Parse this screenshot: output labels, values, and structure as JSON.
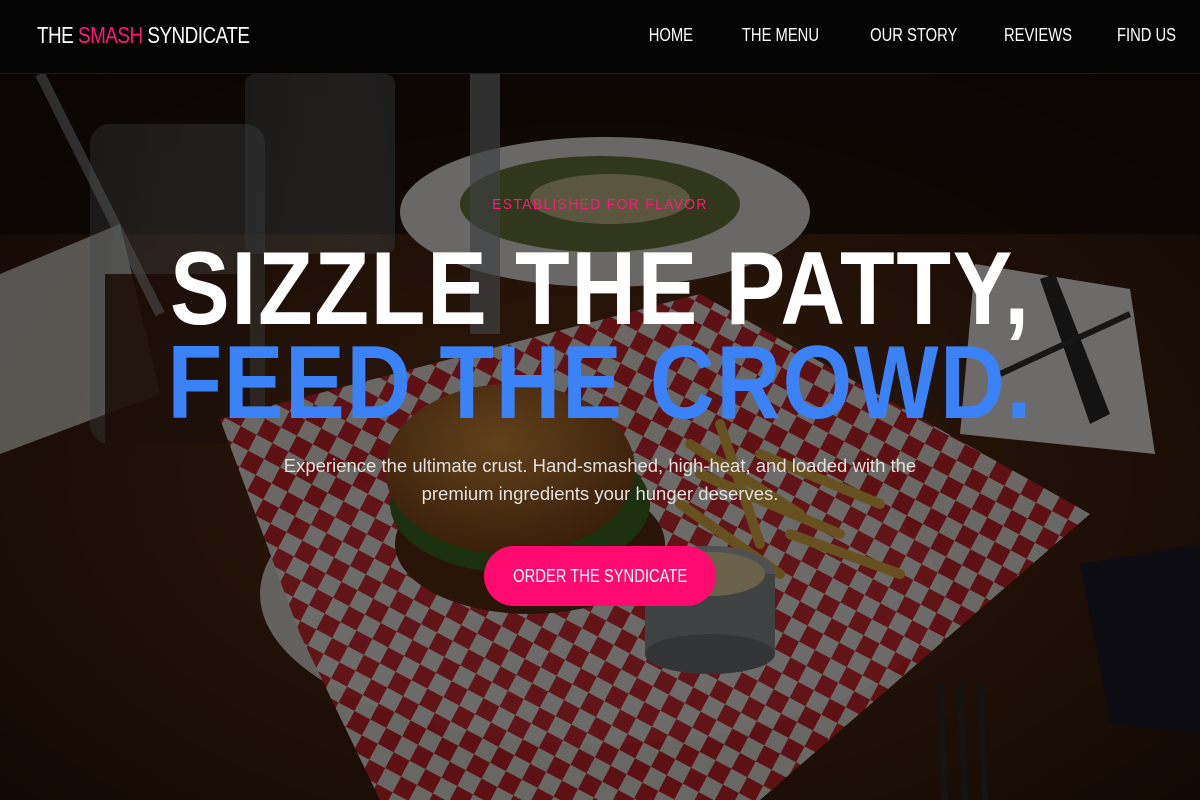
{
  "brand": {
    "part1": "THE ",
    "part2": "SMASH",
    "part3": " SYNDICATE",
    "accent_color": "#ff1a7a"
  },
  "nav": {
    "items": [
      {
        "label": "HOME"
      },
      {
        "label": "THE MENU"
      },
      {
        "label": "OUR STORY"
      },
      {
        "label": "REVIEWS"
      },
      {
        "label": "FIND US"
      }
    ]
  },
  "hero": {
    "eyebrow": "ESTABLISHED FOR FLAVOR",
    "headline_line1": "SIZZLE THE PATTY,",
    "headline_line2": "FEED THE CROWD.",
    "subtitle": "Experience the ultimate crust. Hand-smashed, high-heat, and loaded with the premium ingredients your hunger deserves.",
    "cta_label": "ORDER THE SYNDICATE",
    "background_image": "burger-and-fries-on-checkered-paper-photo",
    "headline_accent_color": "#3b82f6",
    "cta_color": "#ff0a6f"
  }
}
